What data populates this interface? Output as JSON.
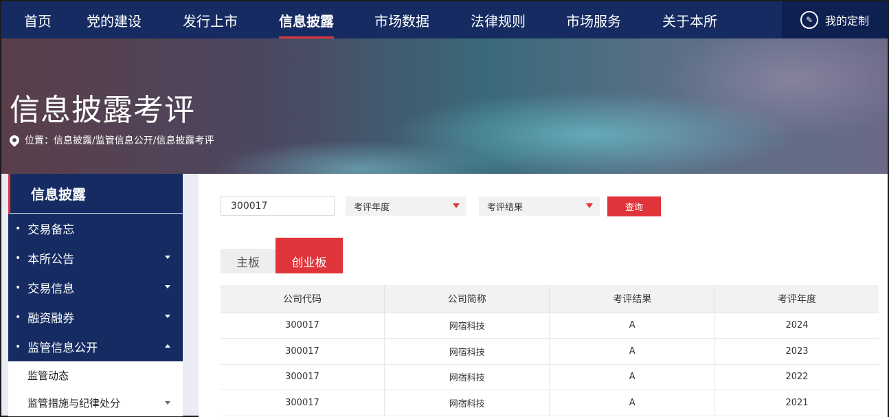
{
  "nav": {
    "items": [
      {
        "label": "首页",
        "active": false
      },
      {
        "label": "党的建设",
        "active": false
      },
      {
        "label": "发行上市",
        "active": false
      },
      {
        "label": "信息披露",
        "active": true
      },
      {
        "label": "市场数据",
        "active": false
      },
      {
        "label": "法律规则",
        "active": false
      },
      {
        "label": "市场服务",
        "active": false
      },
      {
        "label": "关于本所",
        "active": false
      }
    ],
    "custom_label": "我的定制"
  },
  "banner": {
    "title": "信息披露考评",
    "breadcrumb": "位置：信息披露/监管信息公开/信息披露考评"
  },
  "sidebar": {
    "heading": "信息披露",
    "items": [
      {
        "label": "交易备忘"
      },
      {
        "label": "本所公告"
      },
      {
        "label": "交易信息"
      },
      {
        "label": "融资融券"
      },
      {
        "label": "监管信息公开"
      }
    ],
    "subitems": [
      {
        "label": "监管动态"
      },
      {
        "label": "监管措施与纪律处分"
      }
    ]
  },
  "filters": {
    "code_value": "300017",
    "year_select": "考评年度",
    "result_select": "考评结果",
    "query_label": "查询"
  },
  "tabs": {
    "main": "主板",
    "gem": "创业板"
  },
  "table": {
    "headers": [
      "公司代码",
      "公司简称",
      "考评结果",
      "考评年度"
    ],
    "rows": [
      [
        "300017",
        "网宿科技",
        "A",
        "2024"
      ],
      [
        "300017",
        "网宿科技",
        "A",
        "2023"
      ],
      [
        "300017",
        "网宿科技",
        "A",
        "2022"
      ],
      [
        "300017",
        "网宿科技",
        "A",
        "2021"
      ]
    ]
  },
  "colors": {
    "navy": "#152b62",
    "accent_red": "#e0343b"
  }
}
